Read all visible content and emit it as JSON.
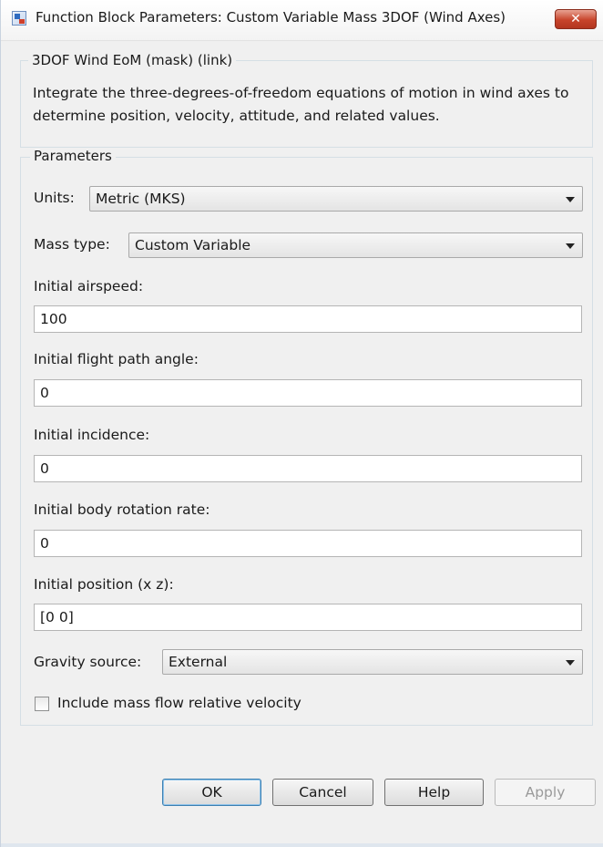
{
  "window": {
    "title": "Function Block Parameters: Custom Variable Mass 3DOF (Wind Axes)",
    "close_symbol": "✕"
  },
  "mask": {
    "legend": "3DOF Wind EoM (mask) (link)",
    "description": "Integrate the three-degrees-of-freedom equations of motion in wind axes to determine position, velocity, attitude, and related values."
  },
  "parameters": {
    "legend": "Parameters",
    "units": {
      "label": "Units:",
      "value": "Metric (MKS)"
    },
    "mass_type": {
      "label": "Mass type:",
      "value": "Custom Variable"
    },
    "initial_airspeed": {
      "label": "Initial airspeed:",
      "value": "100"
    },
    "initial_flight_path_angle": {
      "label": "Initial flight path angle:",
      "value": "0"
    },
    "initial_incidence": {
      "label": "Initial incidence:",
      "value": "0"
    },
    "initial_body_rotation_rate": {
      "label": "Initial body rotation rate:",
      "value": "0"
    },
    "initial_position": {
      "label": "Initial position (x z):",
      "value": "[0 0]"
    },
    "gravity_source": {
      "label": "Gravity source:",
      "value": "External"
    },
    "include_mass_flow": {
      "label": "Include mass flow relative velocity",
      "checked": false
    }
  },
  "buttons": {
    "ok": "OK",
    "cancel": "Cancel",
    "help": "Help",
    "apply": "Apply"
  },
  "icons": {
    "app": "simulink-block-icon",
    "close": "close-icon",
    "dropdown": "chevron-down-icon"
  }
}
